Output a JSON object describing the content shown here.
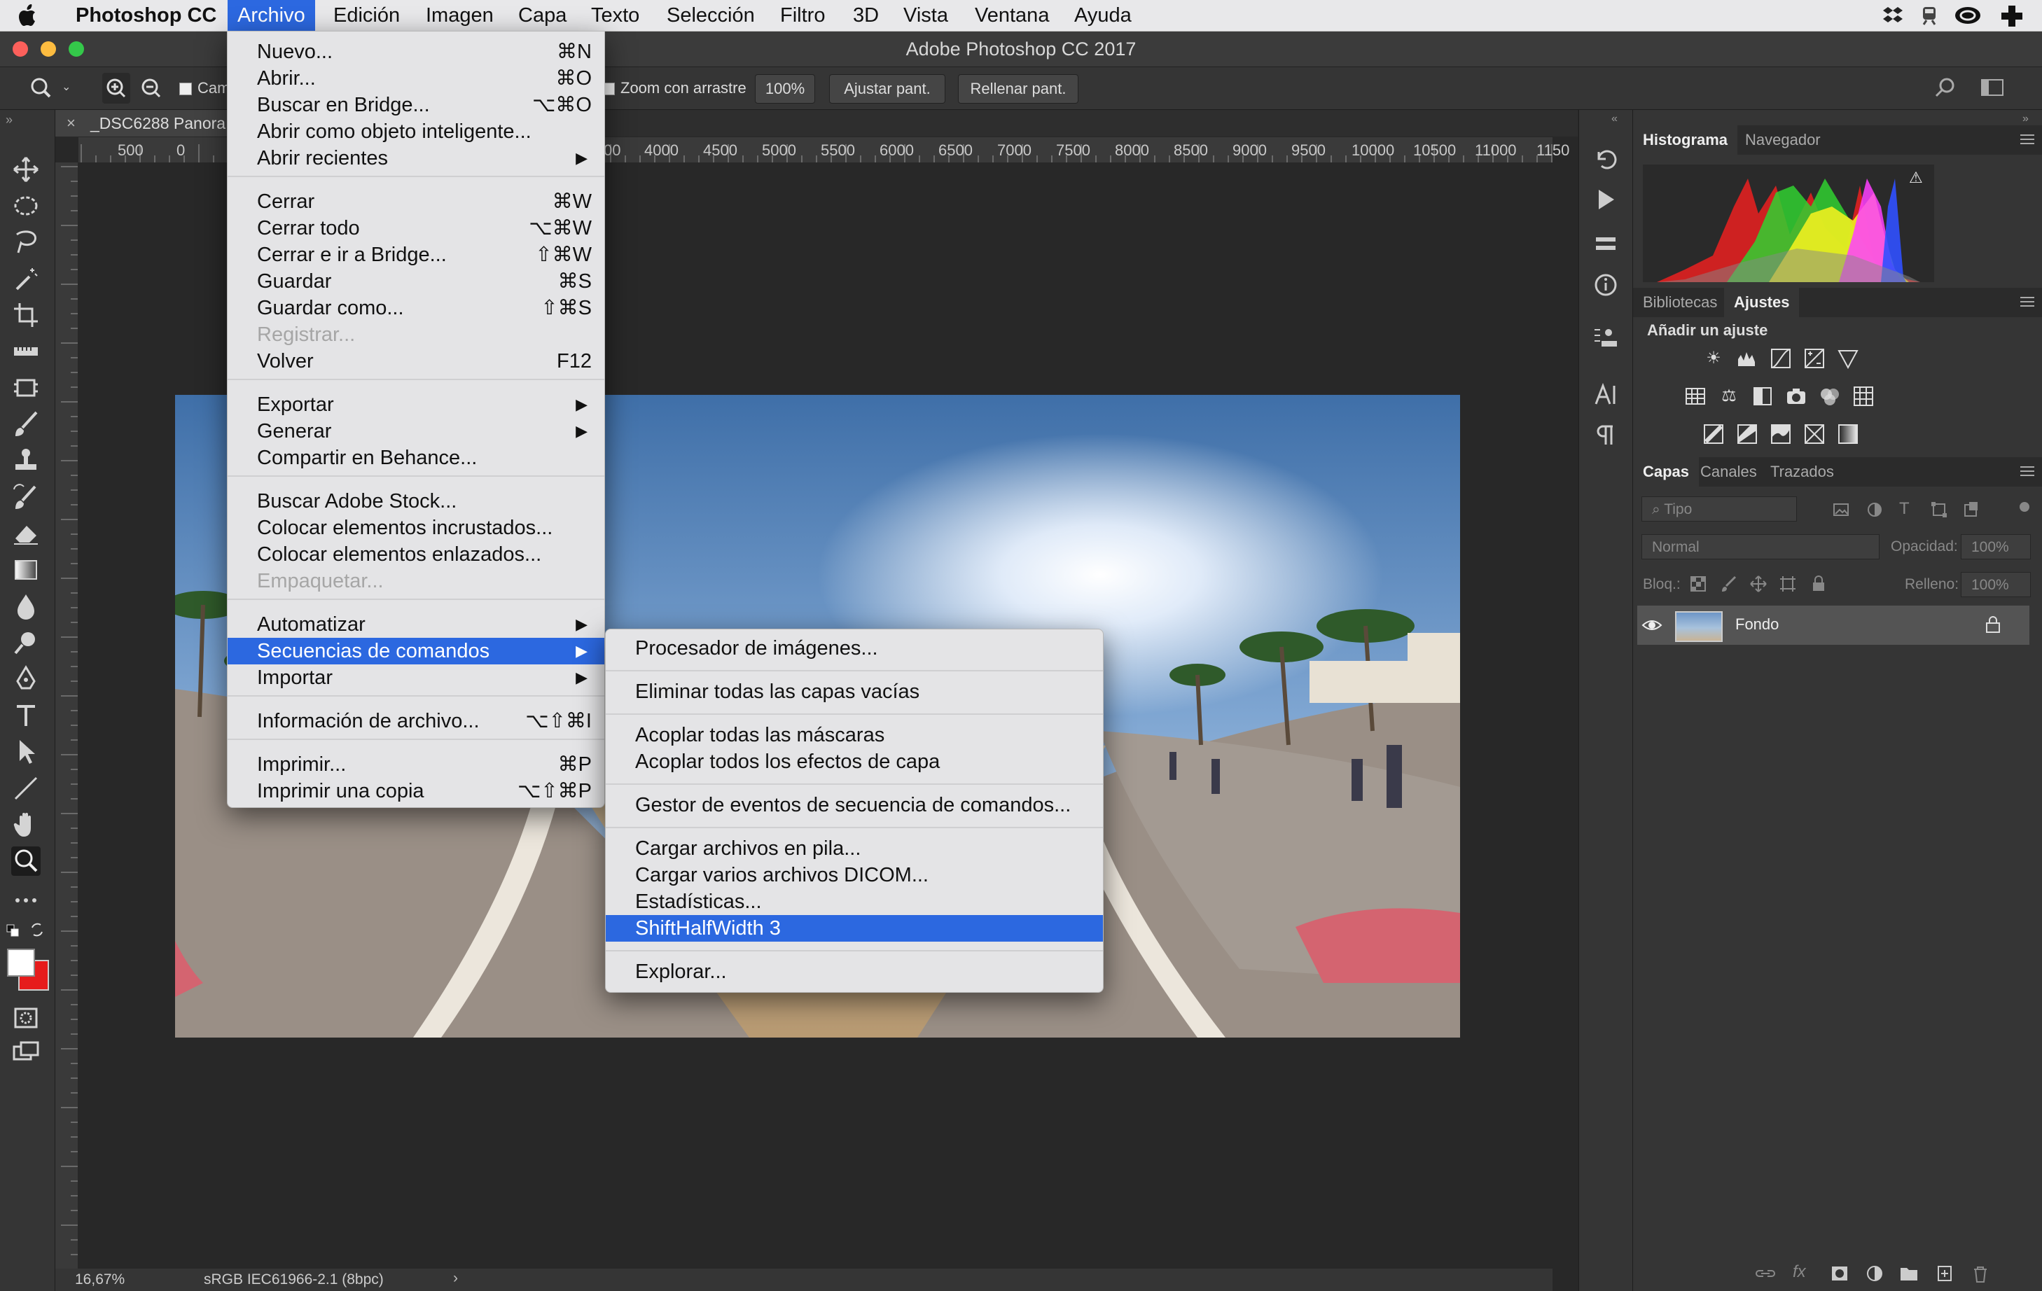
{
  "menubar": {
    "apple": "",
    "app_name": "Photoshop CC",
    "items": [
      "Archivo",
      "Edición",
      "Imagen",
      "Capa",
      "Texto",
      "Selección",
      "Filtro",
      "3D",
      "Vista",
      "Ventana",
      "Ayuda"
    ]
  },
  "window": {
    "title": "Adobe Photoshop CC 2017"
  },
  "options": {
    "check_label_1": "Cam",
    "zoom_drag": "Zoom con arrastre",
    "zoom_100": "100%",
    "fit_screen": "Ajustar pant.",
    "fill_screen": "Rellenar pant."
  },
  "doc_tab": {
    "name": "_DSC6288 Panora"
  },
  "ruler": {
    "h_left": [
      "500",
      "0"
    ],
    "h_right": [
      "00",
      "4000",
      "4500",
      "5000",
      "5500",
      "6000",
      "6500",
      "7000",
      "7500",
      "8000",
      "8500",
      "9000",
      "9500",
      "10000",
      "10500",
      "11000",
      "1150"
    ]
  },
  "status": {
    "zoom": "16,67%",
    "profile": "sRGB IEC61966-2.1 (8bpc)"
  },
  "panels": {
    "histogram_tab": "Histograma",
    "navigator_tab": "Navegador",
    "libraries_tab": "Bibliotecas",
    "adjustments_tab": "Ajustes",
    "add_adjustment": "Añadir un ajuste",
    "layers_tab": "Capas",
    "channels_tab": "Canales",
    "paths_tab": "Trazados",
    "filter_placeholder": "Tipo",
    "blend_mode": "Normal",
    "opacity_label": "Opacidad:",
    "opacity_value": "100%",
    "lock_label": "Bloq.:",
    "fill_label": "Relleno:",
    "fill_value": "100%",
    "layer_name": "Fondo"
  },
  "file_menu": {
    "items": [
      {
        "label": "Nuevo...",
        "shortcut": "⌘N"
      },
      {
        "label": "Abrir...",
        "shortcut": "⌘O"
      },
      {
        "label": "Buscar en Bridge...",
        "shortcut": "⌥⌘O"
      },
      {
        "label": "Abrir como objeto inteligente...",
        "shortcut": ""
      },
      {
        "label": "Abrir recientes",
        "shortcut": "▶"
      },
      {
        "label": "Cerrar",
        "shortcut": "⌘W"
      },
      {
        "label": "Cerrar todo",
        "shortcut": "⌥⌘W"
      },
      {
        "label": "Cerrar e ir a Bridge...",
        "shortcut": "⇧⌘W"
      },
      {
        "label": "Guardar",
        "shortcut": "⌘S"
      },
      {
        "label": "Guardar como...",
        "shortcut": "⇧⌘S"
      },
      {
        "label": "Registrar...",
        "shortcut": ""
      },
      {
        "label": "Volver",
        "shortcut": "F12"
      },
      {
        "label": "Exportar",
        "shortcut": "▶"
      },
      {
        "label": "Generar",
        "shortcut": "▶"
      },
      {
        "label": "Compartir en Behance...",
        "shortcut": ""
      },
      {
        "label": "Buscar Adobe Stock...",
        "shortcut": ""
      },
      {
        "label": "Colocar elementos incrustados...",
        "shortcut": ""
      },
      {
        "label": "Colocar elementos enlazados...",
        "shortcut": ""
      },
      {
        "label": "Empaquetar...",
        "shortcut": ""
      },
      {
        "label": "Automatizar",
        "shortcut": "▶"
      },
      {
        "label": "Secuencias de comandos",
        "shortcut": "▶"
      },
      {
        "label": "Importar",
        "shortcut": "▶"
      },
      {
        "label": "Información de archivo...",
        "shortcut": "⌥⇧⌘I"
      },
      {
        "label": "Imprimir...",
        "shortcut": "⌘P"
      },
      {
        "label": "Imprimir una copia",
        "shortcut": "⌥⇧⌘P"
      }
    ]
  },
  "scripts_menu": {
    "items": [
      "Procesador de imágenes...",
      "Eliminar todas las capas vacías",
      "Acoplar todas las máscaras",
      "Acoplar todos los efectos de capa",
      "Gestor de eventos de secuencia de comandos...",
      "Cargar archivos en pila...",
      "Cargar varios archivos DICOM...",
      "Estadísticas...",
      "ShiftHalfWidth 3",
      "Explorar..."
    ]
  },
  "colors": {
    "accent": "#2c68e0",
    "panel": "#353535",
    "canvas": "#282828"
  }
}
